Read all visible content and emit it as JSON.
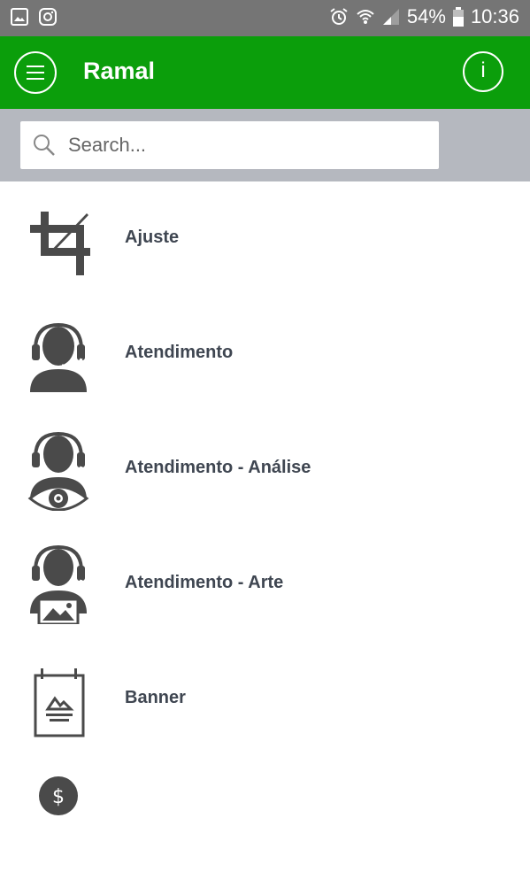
{
  "status_bar": {
    "battery": "54%",
    "time": "10:36"
  },
  "app_bar": {
    "title": "Ramal"
  },
  "search": {
    "placeholder": "Search..."
  },
  "items": [
    {
      "label": "Ajuste",
      "icon": "crop-icon"
    },
    {
      "label": "Atendimento",
      "icon": "headset-agent-icon"
    },
    {
      "label": "Atendimento - Análise",
      "icon": "headset-agent-eye-icon"
    },
    {
      "label": "Atendimento - Arte",
      "icon": "headset-agent-image-icon"
    },
    {
      "label": "Banner",
      "icon": "banner-icon"
    }
  ],
  "colors": {
    "primary": "#0b9e0b",
    "status_bar": "#757575",
    "search_strip": "#b5b8bf",
    "icon": "#4a4a4a",
    "text": "#3f4651"
  }
}
